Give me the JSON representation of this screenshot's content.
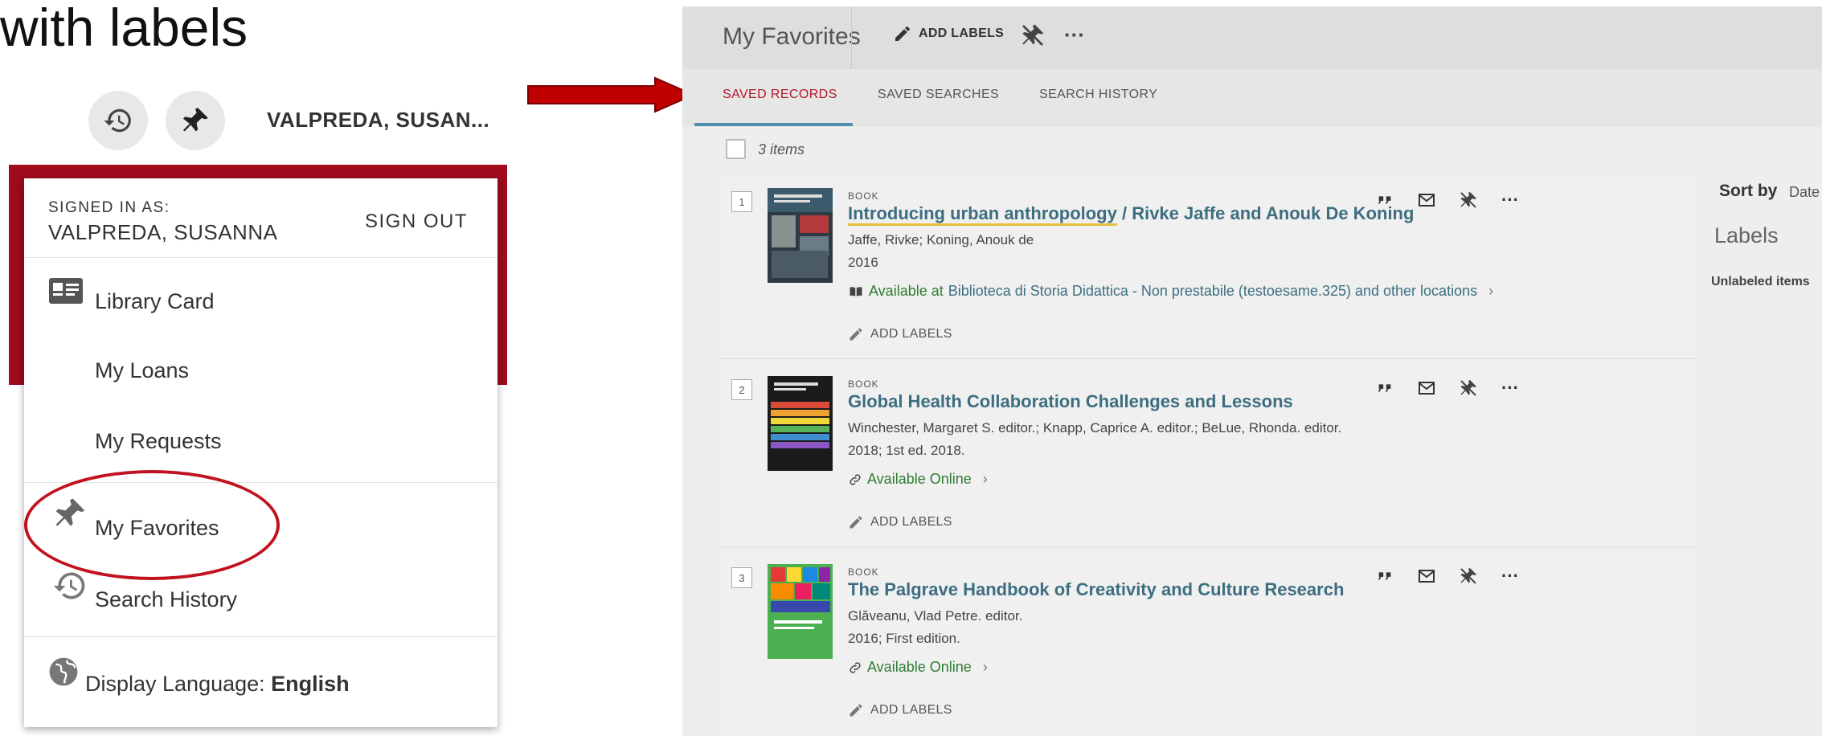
{
  "slide": {
    "title": "with labels"
  },
  "user_bar": {
    "user_name": "VALPREDA, SUSAN..."
  },
  "dropdown": {
    "signed_in_label": "SIGNED IN AS:",
    "signed_in_name": "VALPREDA, SUSANNA",
    "sign_out": "SIGN OUT",
    "items": [
      {
        "label": "Library Card",
        "icon": "id-card-icon"
      },
      {
        "label": "My Loans"
      },
      {
        "label": "My Requests"
      },
      {
        "label": "My Favorites",
        "icon": "pin-icon"
      },
      {
        "label": "Search History",
        "icon": "history-icon"
      }
    ],
    "language_label": "Display Language: ",
    "language_value": "English"
  },
  "favorites": {
    "title": "My Favorites",
    "add_labels": "ADD LABELS",
    "more": "···",
    "tabs": [
      {
        "label": "SAVED RECORDS",
        "active": true
      },
      {
        "label": "SAVED SEARCHES",
        "active": false
      },
      {
        "label": "SEARCH HISTORY",
        "active": false
      }
    ],
    "item_count": "3 items",
    "records": [
      {
        "num": "1",
        "type": "BOOK",
        "title_main": "Introducing urban anthropology",
        "title_rest": " / Rivke Jaffe and Anouk De Koning",
        "authors": "Jaffe, Rivke; Koning, Anouk de",
        "date": "2016",
        "avail_prefix": "Available at",
        "avail_location": "Biblioteca di Storia  Didattica - Non prestabile (testoesame.325) and other locations",
        "add_labels": "ADD LABELS"
      },
      {
        "num": "2",
        "type": "BOOK",
        "title_main": "Global Health Collaboration Challenges and Lessons",
        "title_rest": "",
        "authors": "Winchester, Margaret S. editor.; Knapp, Caprice A. editor.; BeLue, Rhonda. editor.",
        "date": "2018; 1st ed. 2018.",
        "avail_prefix": "Available Online",
        "avail_location": "",
        "add_labels": "ADD LABELS"
      },
      {
        "num": "3",
        "type": "BOOK",
        "title_main": "The Palgrave Handbook of Creativity and Culture Research",
        "title_rest": "",
        "authors": "Glăveanu, Vlad Petre. editor.",
        "date": "2016; First edition.",
        "avail_prefix": "Available Online",
        "avail_location": "",
        "add_labels": "ADD LABELS"
      }
    ],
    "sort_by_label": "Sort by",
    "sort_by_value": "Date",
    "labels_heading": "Labels",
    "unlabeled_items": "Unlabeled items"
  },
  "colors": {
    "brand_red": "#9e0b1c",
    "active_tab": "#b11627",
    "link_teal": "#3c6e80",
    "available_green": "#2e7d32",
    "annotation_red": "#c1121f"
  }
}
